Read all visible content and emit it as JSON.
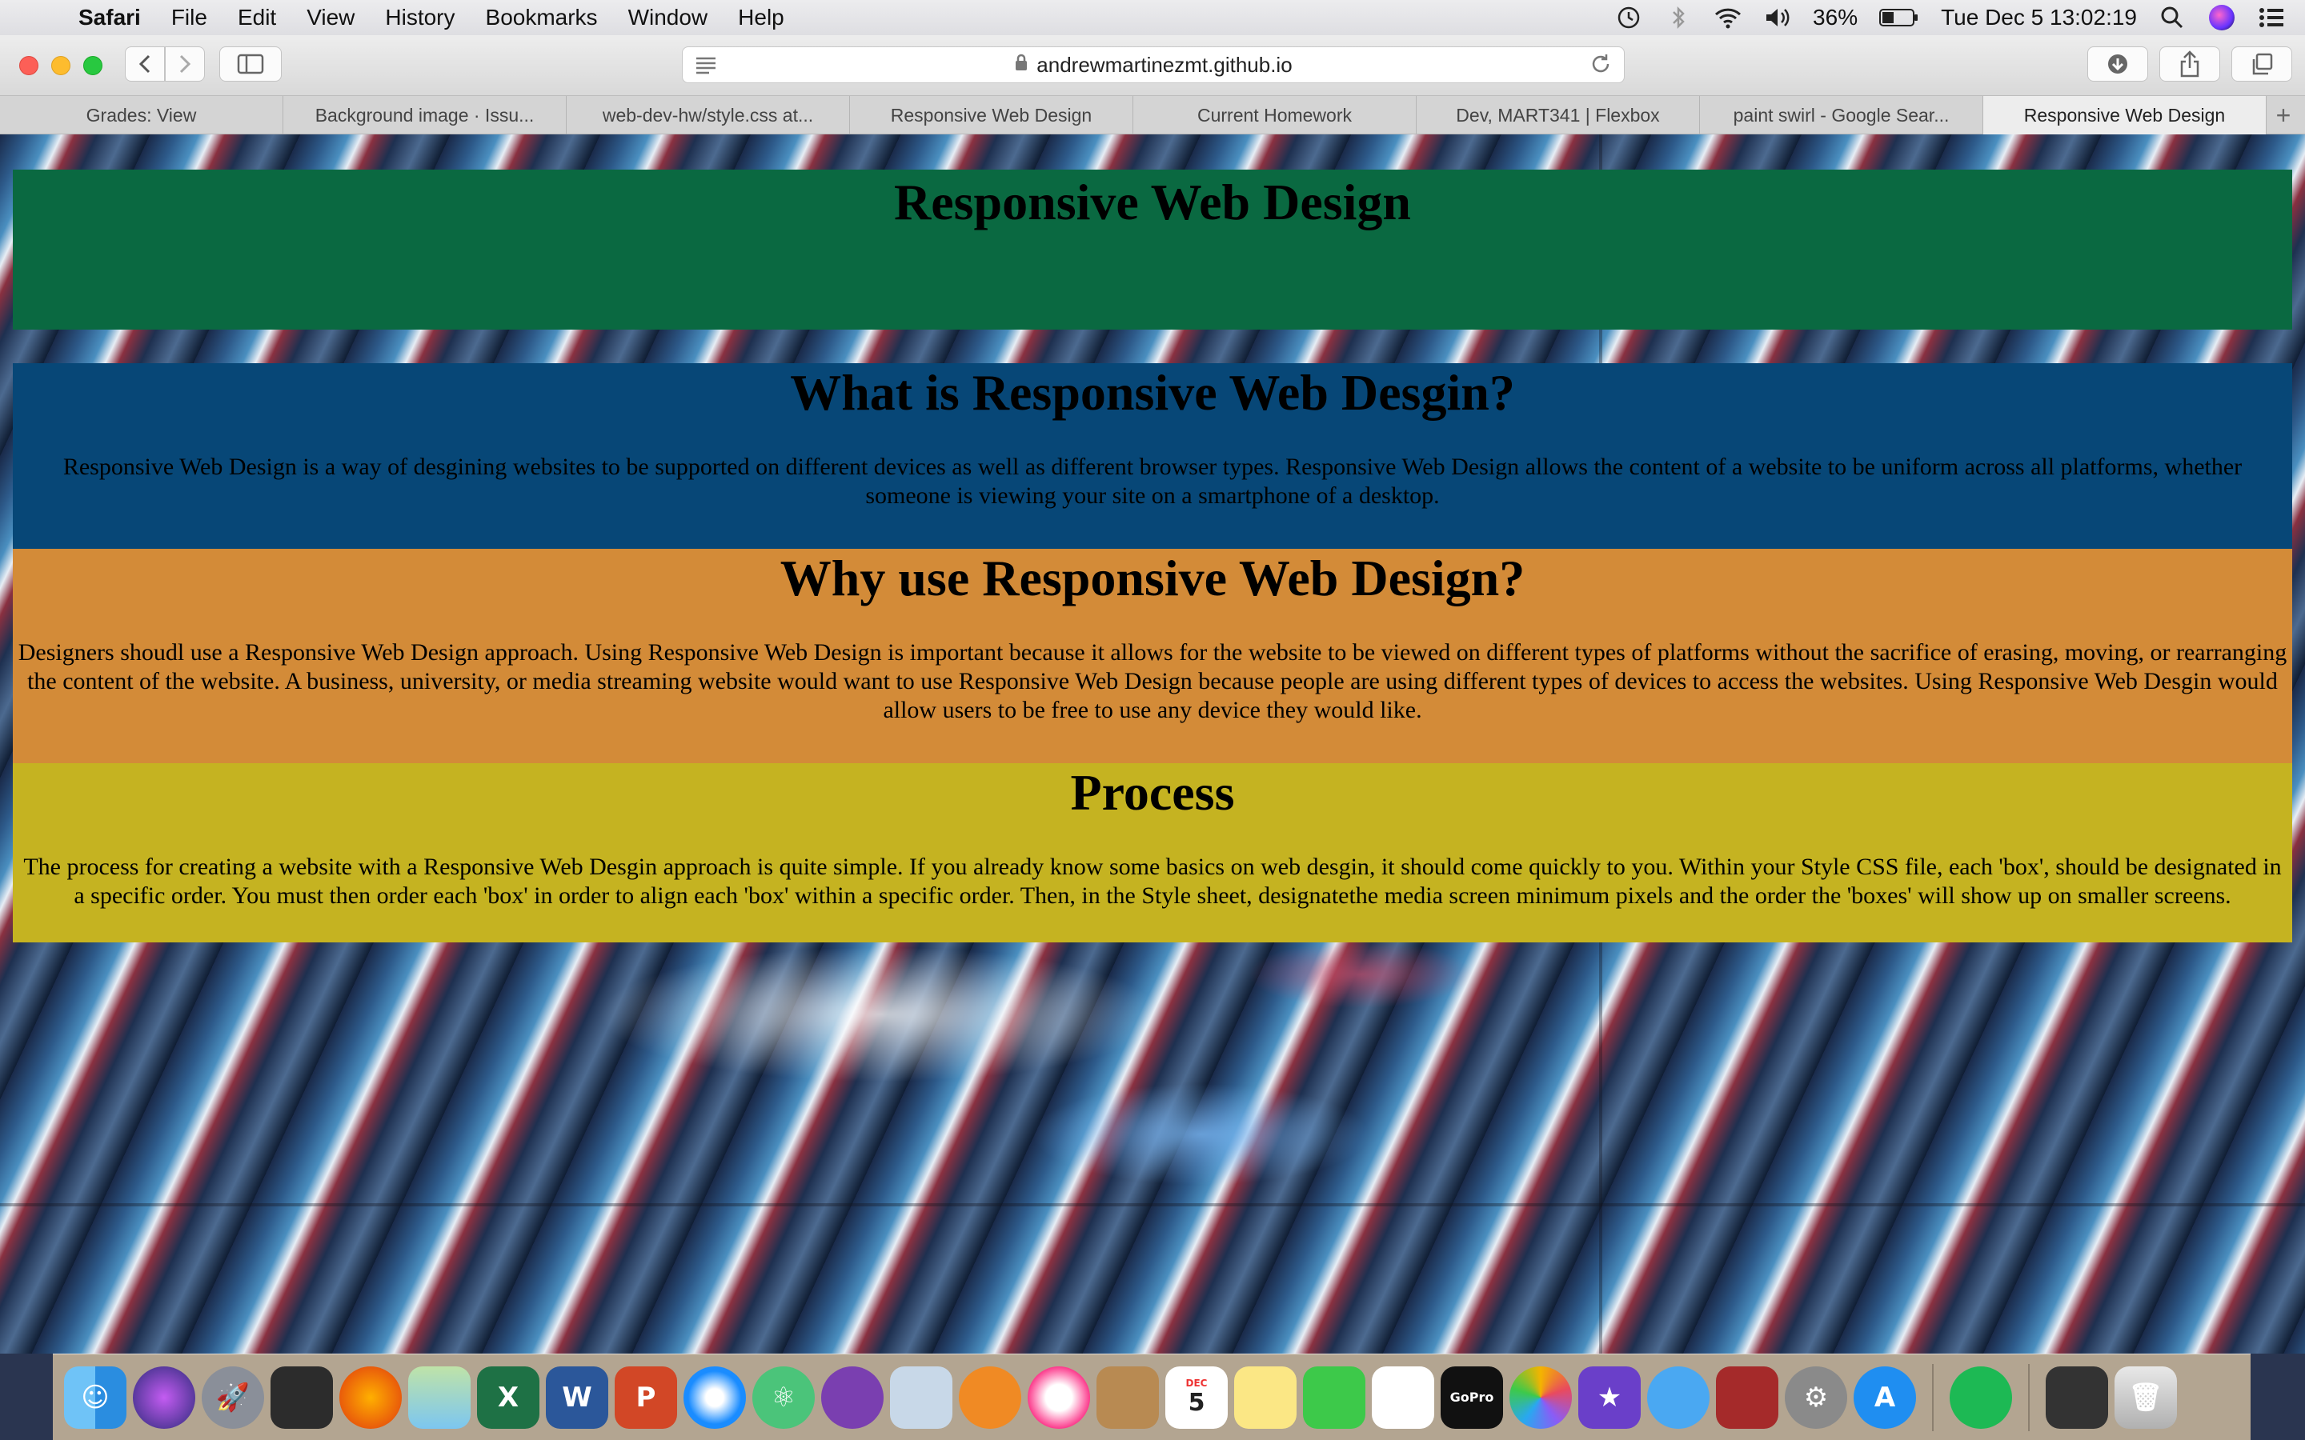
{
  "menubar": {
    "app_name": "Safari",
    "menus": [
      "File",
      "Edit",
      "View",
      "History",
      "Bookmarks",
      "Window",
      "Help"
    ],
    "battery": "36%",
    "clock": "Tue Dec 5  13:02:19"
  },
  "toolbar": {
    "url": "andrewmartinezmt.github.io"
  },
  "tabs": [
    {
      "label": "Grades: View"
    },
    {
      "label": "Background image · Issu..."
    },
    {
      "label": "web-dev-hw/style.css at..."
    },
    {
      "label": "Responsive Web Design"
    },
    {
      "label": "Current Homework"
    },
    {
      "label": "Dev, MART341 | Flexbox"
    },
    {
      "label": "paint swirl - Google Sear..."
    },
    {
      "label": "Responsive Web Design"
    }
  ],
  "page": {
    "header_title": "Responsive Web Design",
    "what": {
      "heading": "What is Responsive Web Desgin?",
      "body": "Responsive Web Design is a way of desgining websites to be supported on different devices as well as different browser types. Responsive Web Design allows the content of a website to be uniform across all platforms, whether someone is viewing your site on a smartphone of a desktop."
    },
    "why": {
      "heading": "Why use Responsive Web Design?",
      "body": "Designers shoudl use a Responsive Web Design approach. Using Responsive Web Design is important because it allows for the website to be viewed on different types of platforms without the sacrifice of erasing, moving, or rearranging the content of the website. A business, university, or media streaming website would want to use Responsive Web Design because people are using different types of devices to access the websites. Using Responsive Web Desgin would allow users to be free to use any device they would like."
    },
    "process": {
      "heading": "Process",
      "body": "The process for creating a website with a Responsive Web Desgin approach is quite simple. If you already know some basics on web desgin, it should come quickly to you. Within your Style CSS file, each 'box', should be designated in a specific order. You must then order each 'box' in order to align each 'box' within a specific order. Then, in the Style sheet, designatethe media screen minimum pixels and the order the 'boxes' will show up on smaller screens."
    }
  },
  "dock": {
    "calendar_day": "5",
    "calendar_month": "DEC",
    "gopro_label": "GoPro",
    "apps": [
      "finder-icon",
      "siri-icon",
      "launchpad-icon",
      "photo-booth-icon",
      "firefox-icon",
      "maps-icon",
      "excel-icon",
      "word-icon",
      "powerpoint-icon",
      "safari-icon",
      "atom-icon",
      "github-desktop-icon",
      "preview-icon",
      "ibooks-icon",
      "itunes-icon",
      "contacts-icon",
      "calendar-icon",
      "notes-icon",
      "facetime-icon",
      "reminders-icon",
      "gopro-icon",
      "photos-icon",
      "imovie-icon",
      "messages-icon",
      "photo-app-icon",
      "system-preferences-icon",
      "app-store-icon",
      "spotify-icon",
      "stacks-icon",
      "trash-icon"
    ]
  }
}
